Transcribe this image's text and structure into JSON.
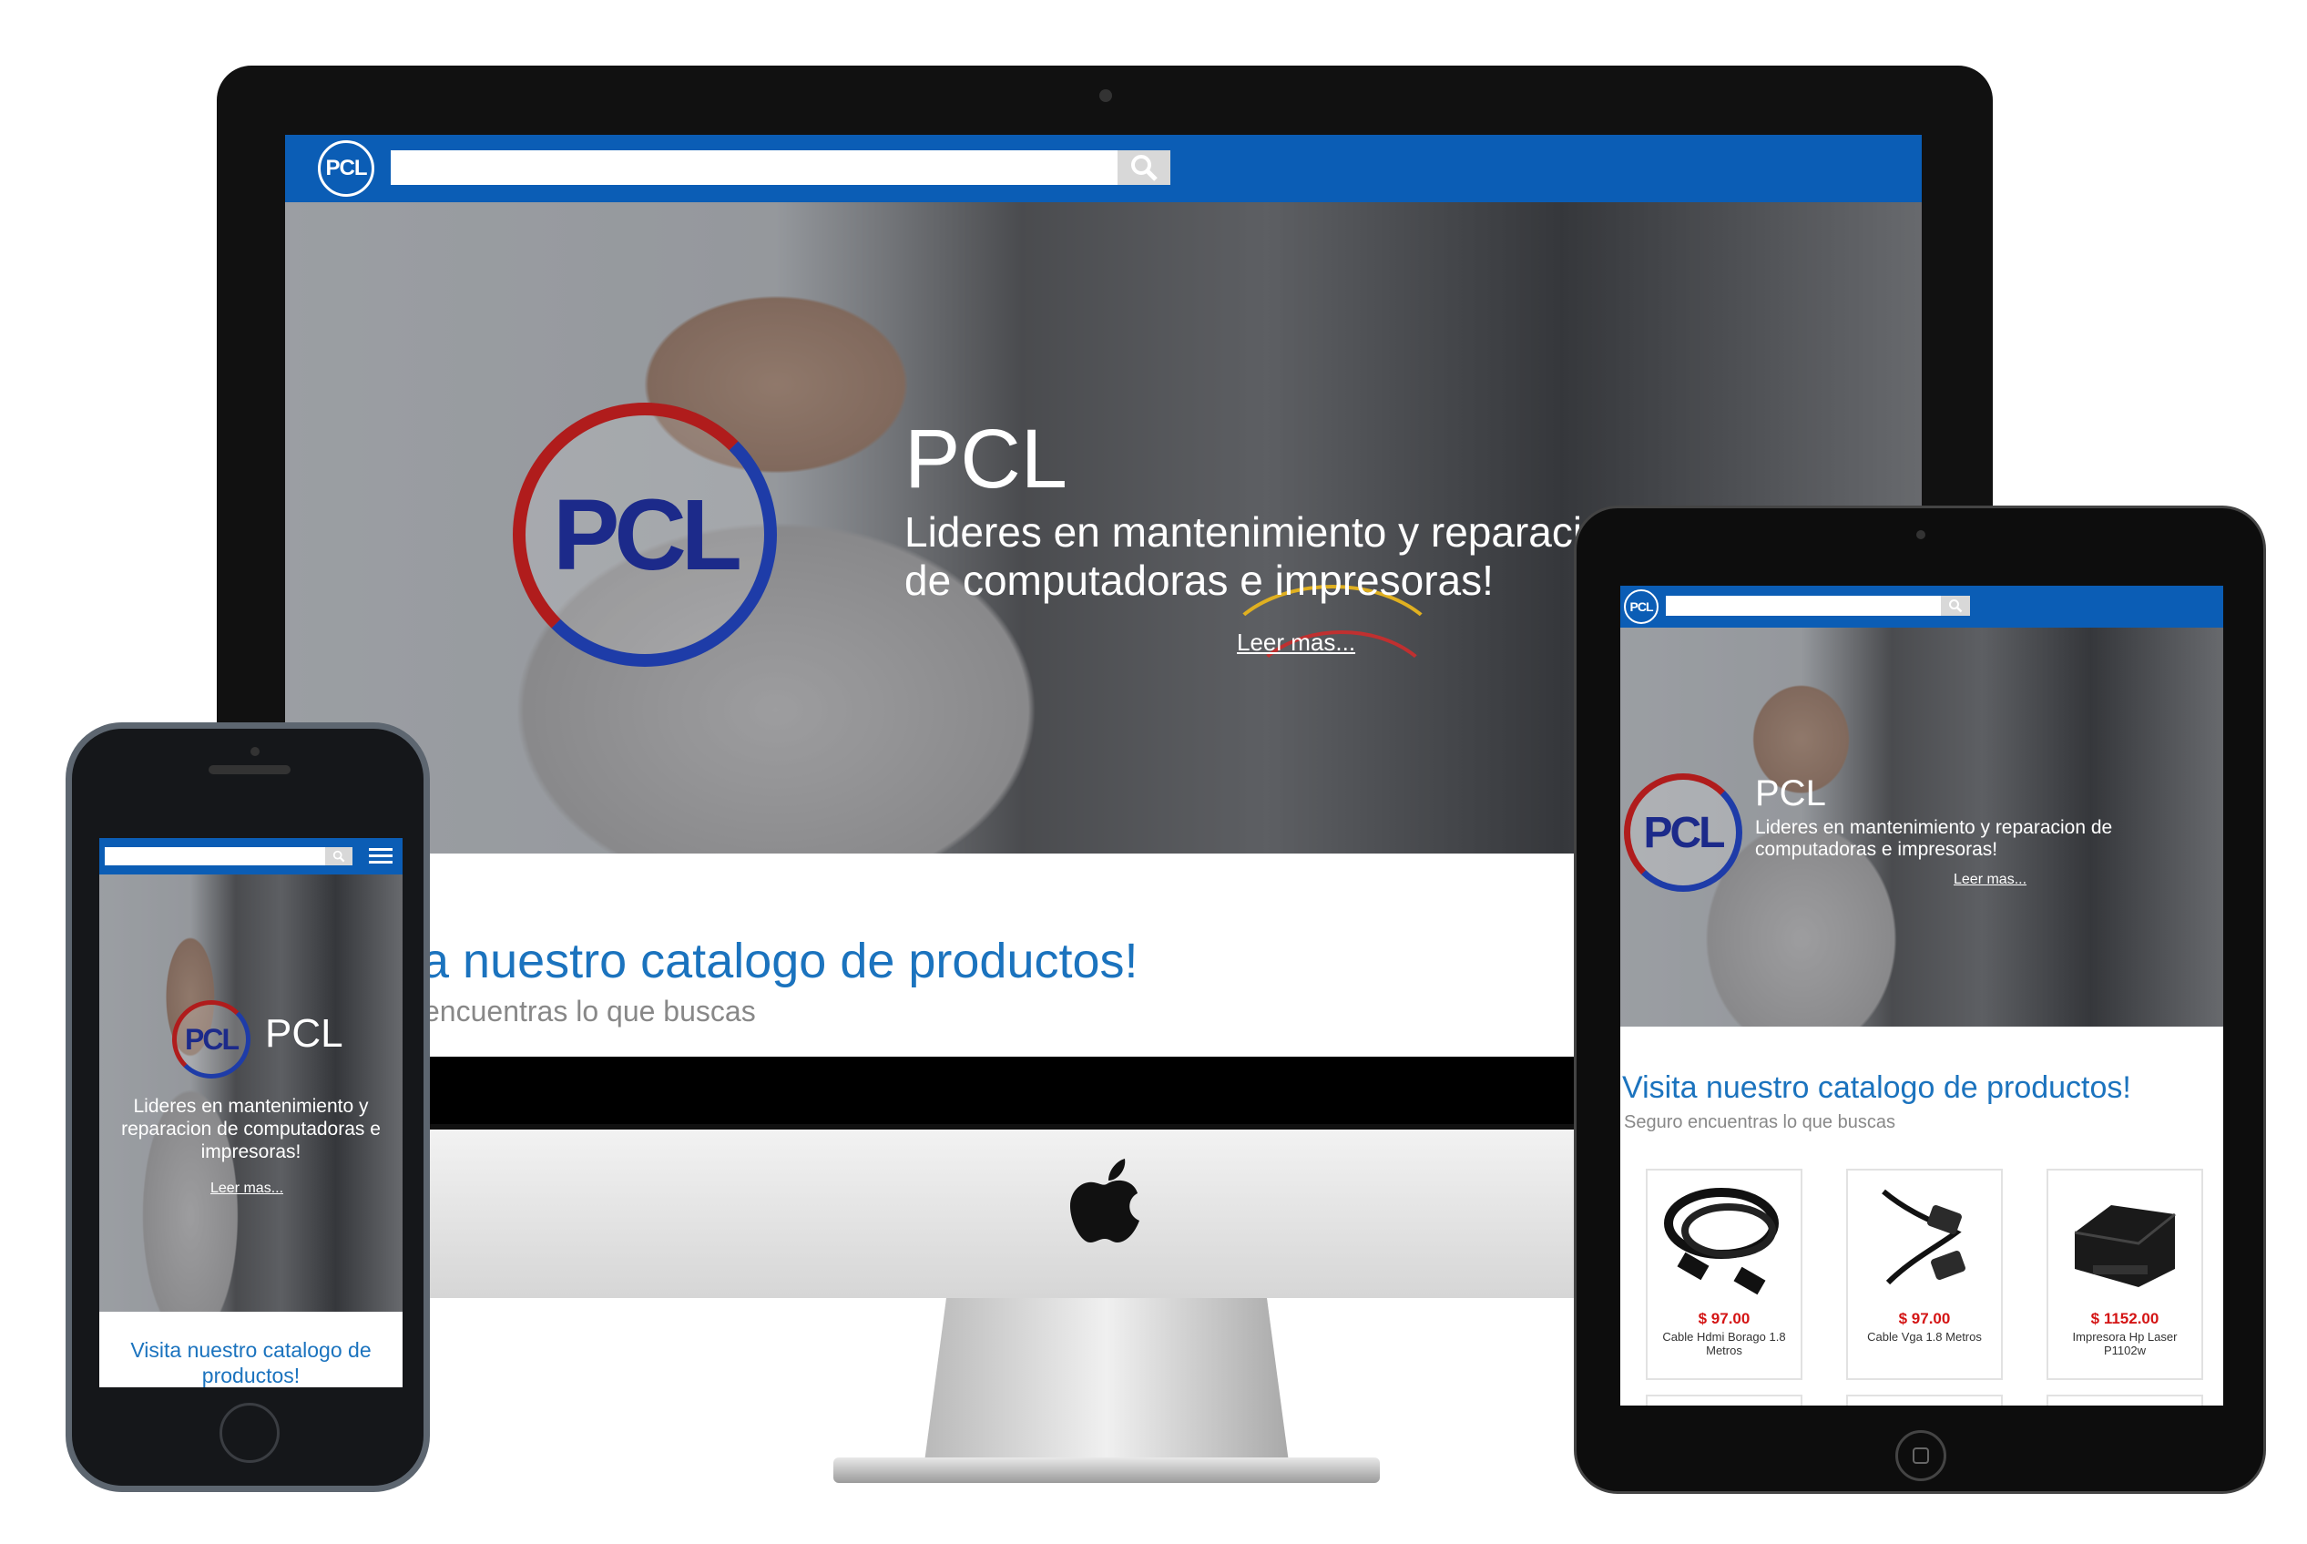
{
  "brand": {
    "logo_text": "PCL",
    "accent": "#0b5db5",
    "price_color": "#d41414"
  },
  "desktop": {
    "hero_title": "PCL",
    "hero_subtitle_line1": "Lideres en mantenimiento y reparaci",
    "hero_subtitle_line2": "de computadoras e impresoras!",
    "read_more": "Leer mas...",
    "catalog_title": "a nuestro catalogo de productos!",
    "catalog_subtitle": "encuentras lo que buscas",
    "search_placeholder": ""
  },
  "tablet": {
    "hero_title": "PCL",
    "hero_subtitle": "Lideres en mantenimiento y reparacion de computadoras e impresoras!",
    "read_more": "Leer mas...",
    "catalog_title": "Visita nuestro catalogo de productos!",
    "catalog_subtitle": "Seguro encuentras lo que buscas",
    "products": [
      {
        "price": "$ 97.00",
        "name": "Cable Hdmi Borago 1.8 Metros"
      },
      {
        "price": "$ 97.00",
        "name": "Cable Vga 1.8 Metros"
      },
      {
        "price": "$ 1152.00",
        "name": "Impresora Hp Laser P1102w"
      }
    ]
  },
  "phone": {
    "hero_title": "PCL",
    "hero_subtitle": "Lideres en mantenimiento y reparacion de computadoras e impresoras!",
    "read_more": "Leer mas...",
    "catalog_title": "Visita nuestro catalogo de productos!"
  },
  "icons": {
    "search": "search-icon",
    "menu": "hamburger-menu-icon",
    "apple": "apple-logo-icon",
    "home": "home-button-icon"
  }
}
